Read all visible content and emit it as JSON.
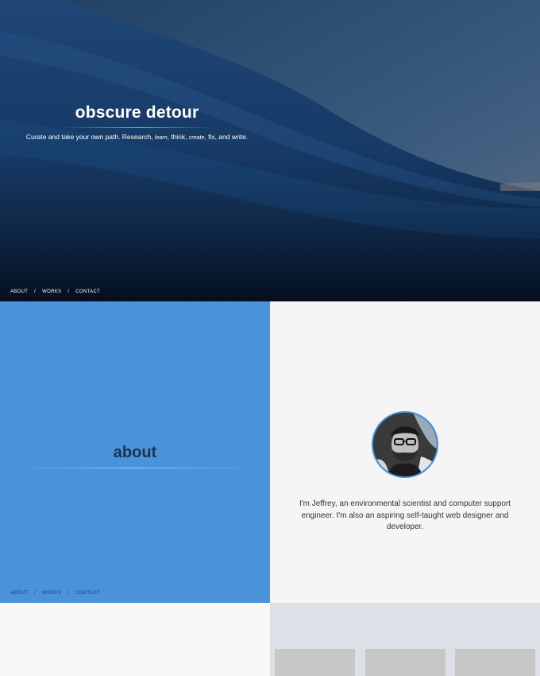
{
  "hero": {
    "title": "obscure detour",
    "tagline_part1": "Curate and take your own path. Research, ",
    "tagline_learn": "learn",
    "tagline_part2": ", think, ",
    "tagline_create": "create",
    "tagline_part3": ", fix, and write."
  },
  "nav": {
    "items": [
      "ABOUT",
      "WORKS",
      "CONTACT"
    ],
    "separator": "/"
  },
  "about": {
    "heading": "about"
  },
  "bio": {
    "text": "I'm Jeffrey, an environmental scientist and computer support engineer. I'm also an aspiring self-taught web designer and developer.",
    "avatar_icon": "portrait-photo"
  },
  "colors": {
    "about_panel": "#4a92d9",
    "bio_panel": "#f5f5f5",
    "works_panel": "#dde1e7",
    "heading_dark": "#1e3350"
  }
}
